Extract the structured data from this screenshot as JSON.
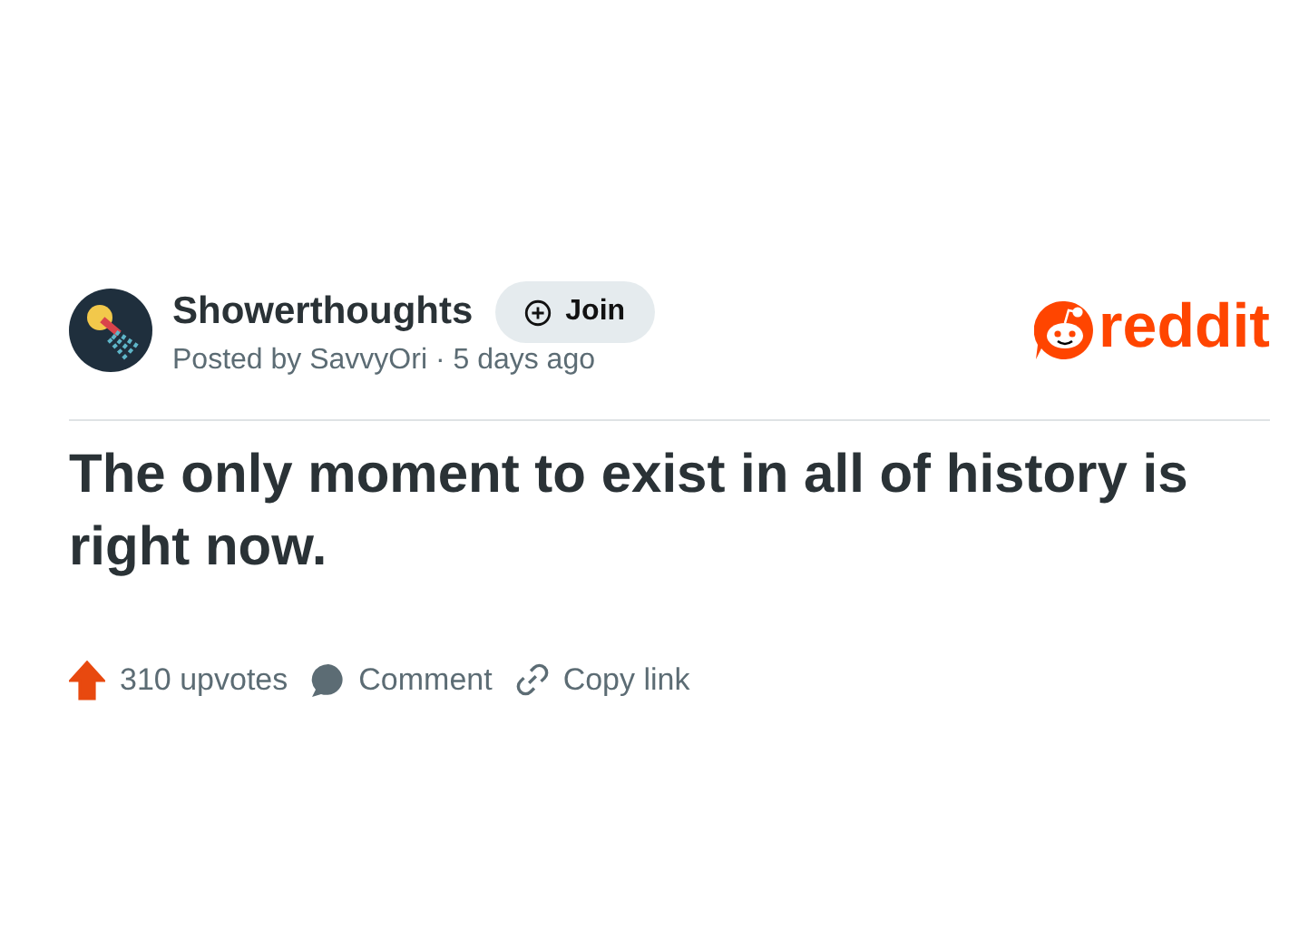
{
  "post": {
    "community": "Showerthoughts",
    "join_label": "Join",
    "byline": "Posted by SavvyOri · 5 days ago",
    "brand": "reddit",
    "title": "The only moment to exist in all of history is right now.",
    "upvoted": true,
    "upvotes": "310 upvotes",
    "comment_label": "Comment",
    "copy_label": "Copy link"
  }
}
